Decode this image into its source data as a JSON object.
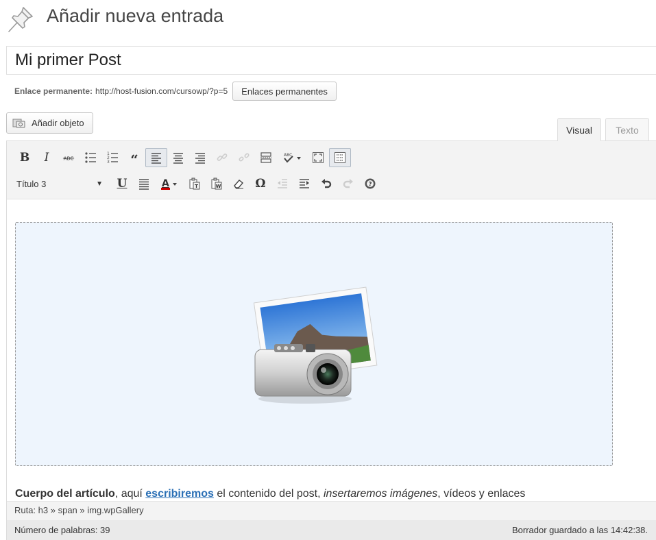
{
  "header": {
    "title": "Añadir nueva entrada",
    "icon": "pushpin-icon"
  },
  "post_title": {
    "value": "Mi primer Post"
  },
  "permalink": {
    "label": "Enlace permanente:",
    "url": "http://host-fusion.com/cursowp/?p=5",
    "button_label": "Enlaces permanentes"
  },
  "media": {
    "button_label": "Añadir objeto",
    "icon": "media-camera-icon"
  },
  "editor_tabs": [
    {
      "label": "Visual",
      "active": true
    },
    {
      "label": "Texto",
      "active": false
    }
  ],
  "toolbar": {
    "row1": [
      "bold-icon",
      "italic-icon",
      "strikethrough-icon",
      "bullet-list-icon",
      "numbered-list-icon",
      "blockquote-icon",
      "align-left-icon",
      "align-center-icon",
      "align-right-icon",
      "insert-link-icon",
      "remove-link-icon",
      "insert-more-icon",
      "spellcheck-icon",
      "fullscreen-icon",
      "kitchen-sink-icon"
    ],
    "format_select": {
      "selected": "Título 3"
    },
    "row2": [
      "underline-icon",
      "justify-icon",
      "text-color-icon",
      "paste-text-icon",
      "paste-word-icon",
      "clear-formatting-icon",
      "special-character-icon",
      "outdent-icon",
      "indent-icon",
      "undo-icon",
      "redo-icon",
      "help-icon"
    ]
  },
  "content": {
    "gallery_icon": "gallery-camera-photo-icon",
    "text_segments": [
      {
        "text": "Cuerpo del artículo",
        "style": "bold"
      },
      {
        "text": ", aquí ",
        "style": "normal"
      },
      {
        "text": "escribiremos",
        "style": "link"
      },
      {
        "text": " el contenido del post, ",
        "style": "normal"
      },
      {
        "text": "insertaremos imágenes",
        "style": "italic"
      },
      {
        "text": ", vídeos y enlaces",
        "style": "normal"
      }
    ]
  },
  "status": {
    "path": "Ruta: h3 » span » img.wpGallery",
    "word_count": "Número de palabras: 39",
    "autosave": "Borrador guardado a las 14:42:38."
  },
  "colors": {
    "toolbar_bg": "#f3f3f3",
    "gallery_bg": "#eef5fd",
    "link": "#2a6fb5",
    "text_color_bar": "#cc0000"
  }
}
